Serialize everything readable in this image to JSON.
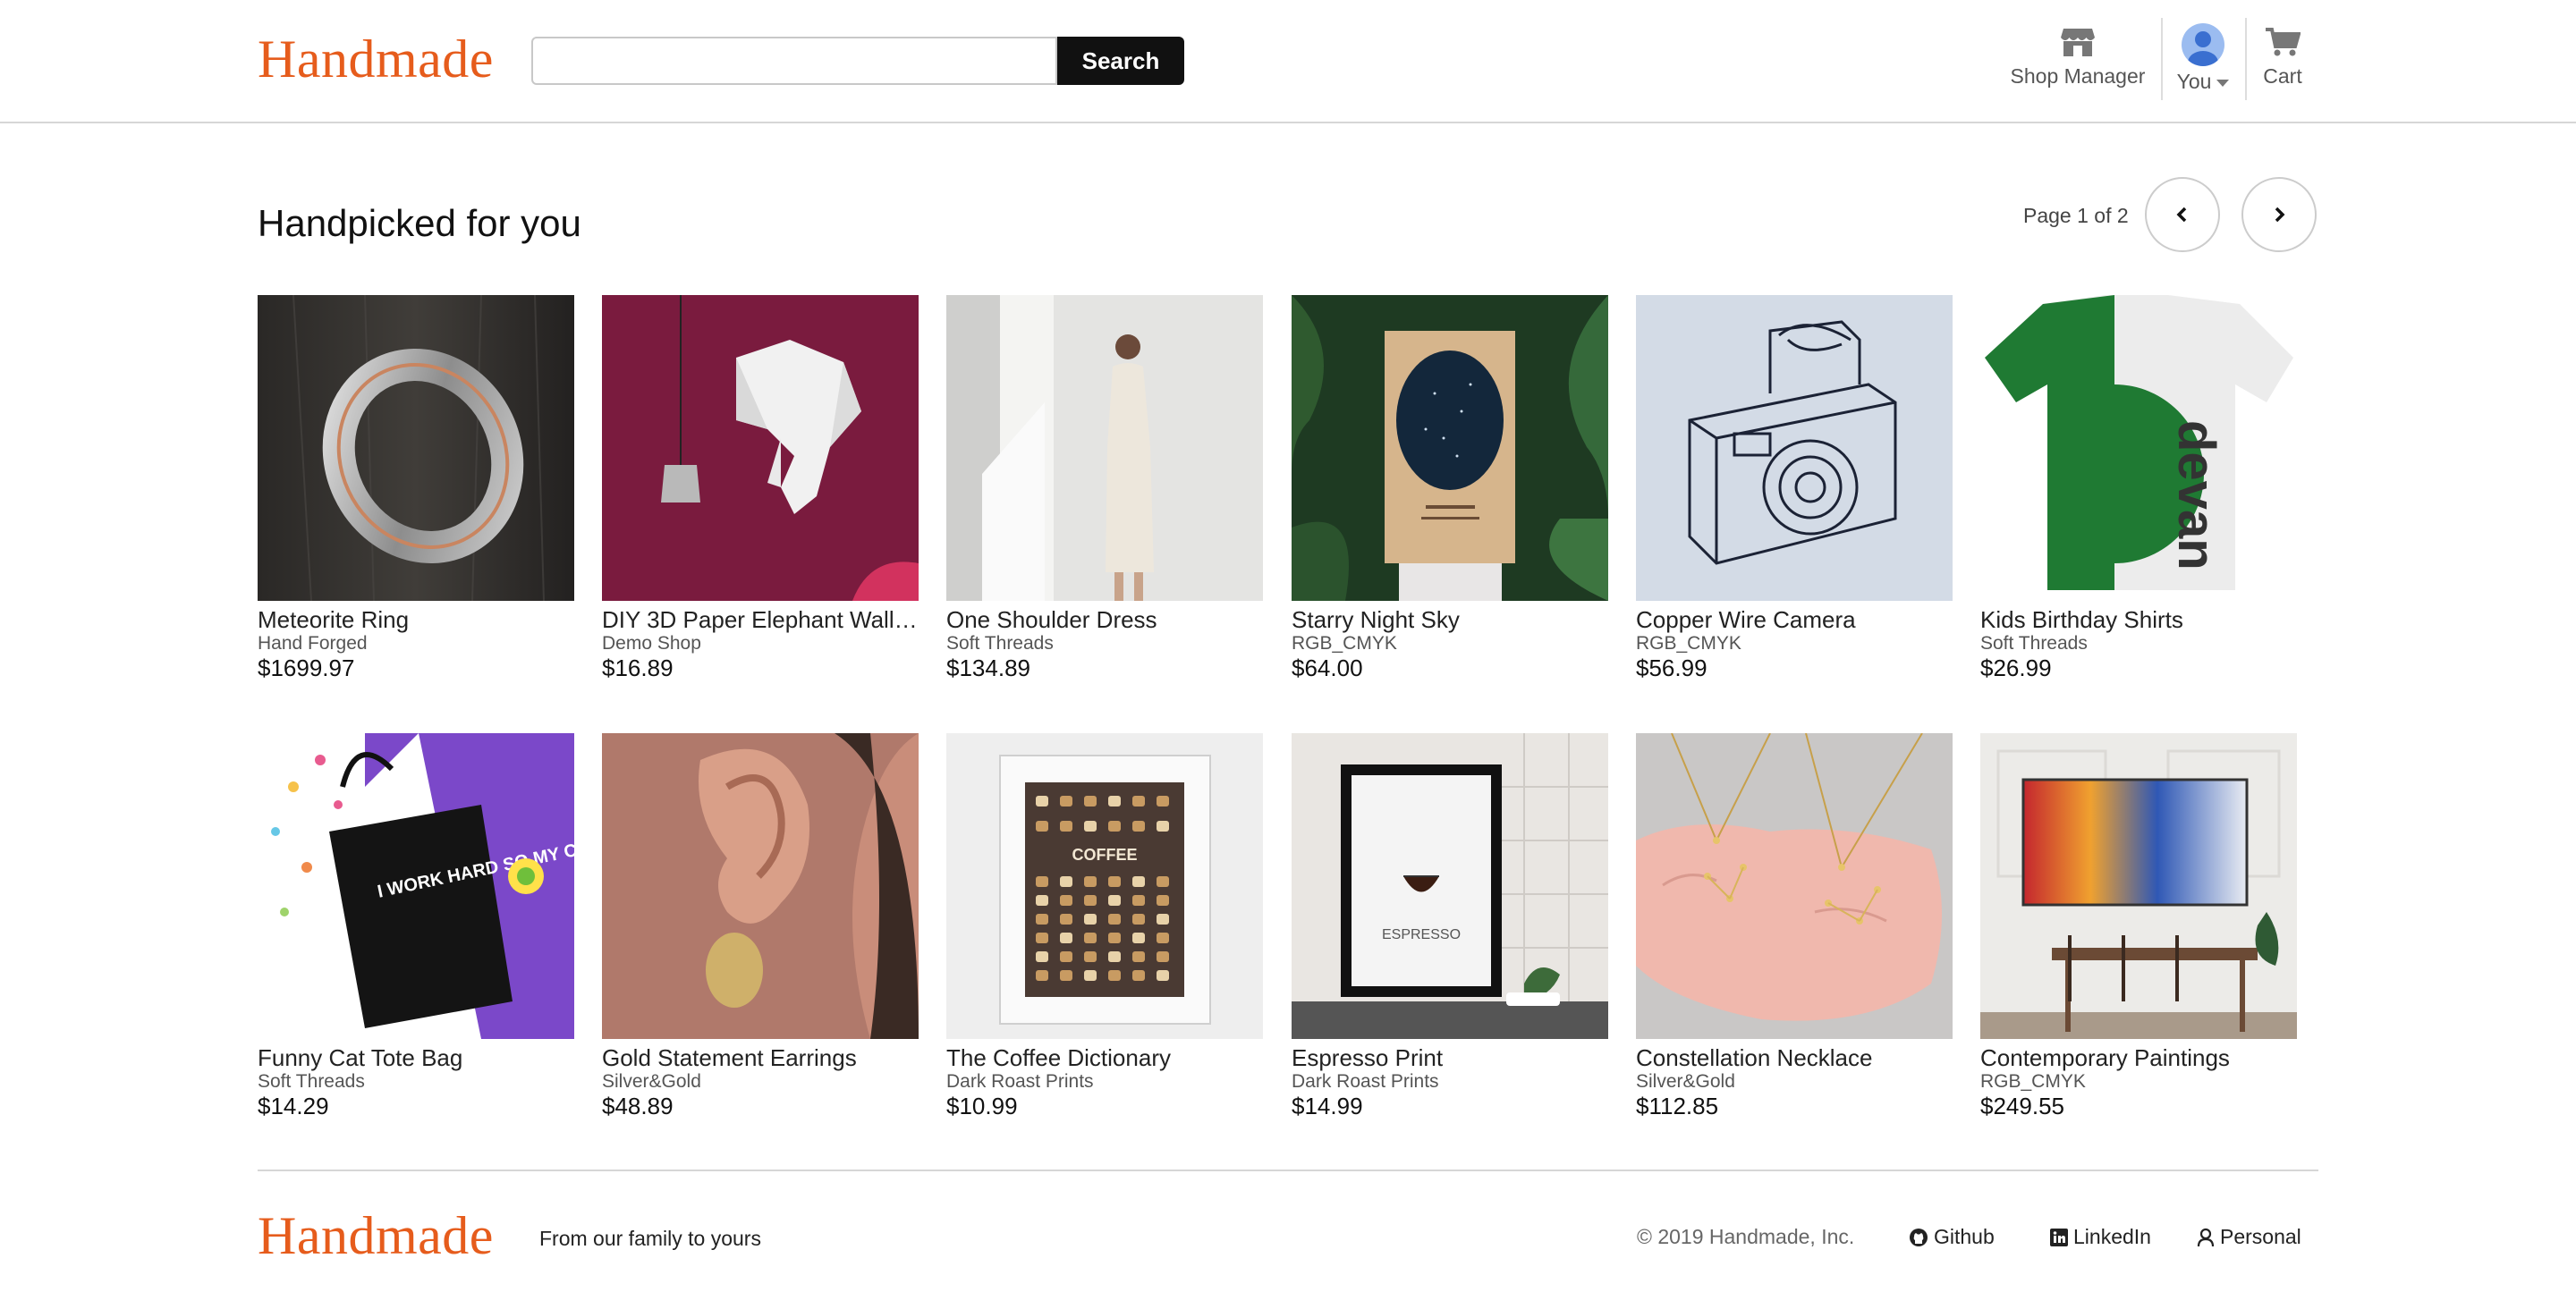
{
  "header": {
    "logo": "Handmade",
    "search_placeholder": "",
    "search_button": "Search",
    "nav": {
      "shop_manager": "Shop Manager",
      "you": "You",
      "cart": "Cart"
    }
  },
  "main": {
    "title": "Handpicked for you",
    "page_indicator": "Page 1 of 2",
    "products": [
      {
        "title": "Meteorite Ring",
        "shop": "Hand Forged",
        "price": "$1699.97",
        "image": "ring"
      },
      {
        "title": "DIY 3D Paper Elephant Wall ...",
        "shop": "Demo Shop",
        "price": "$16.89",
        "image": "elephant"
      },
      {
        "title": "One Shoulder Dress",
        "shop": "Soft Threads",
        "price": "$134.89",
        "image": "dress"
      },
      {
        "title": "Starry Night Sky",
        "shop": "RGB_CMYK",
        "price": "$64.00",
        "image": "starmap"
      },
      {
        "title": "Copper Wire Camera",
        "shop": "RGB_CMYK",
        "price": "$56.99",
        "image": "camera"
      },
      {
        "title": "Kids Birthday Shirts",
        "shop": "Soft Threads",
        "price": "$26.99",
        "image": "shirt"
      },
      {
        "title": "Funny Cat Tote Bag",
        "shop": "Soft Threads",
        "price": "$14.29",
        "image": "tote"
      },
      {
        "title": "Gold Statement Earrings",
        "shop": "Silver&Gold",
        "price": "$48.89",
        "image": "earring"
      },
      {
        "title": "The Coffee Dictionary",
        "shop": "Dark Roast Prints",
        "price": "$10.99",
        "image": "coffee-poster"
      },
      {
        "title": "Espresso Print",
        "shop": "Dark Roast Prints",
        "price": "$14.99",
        "image": "espresso"
      },
      {
        "title": "Constellation Necklace",
        "shop": "Silver&Gold",
        "price": "$112.85",
        "image": "necklace"
      },
      {
        "title": "Contemporary Paintings",
        "shop": "RGB_CMYK",
        "price": "$249.55",
        "image": "painting"
      }
    ],
    "image_text": {
      "shirt": "devan",
      "tote": "I WORK HARD SO MY CAT CAN HAVE A BETTER LIFE",
      "coffee": "COFFEE",
      "espresso": "ESPRESSO"
    }
  },
  "footer": {
    "logo": "Handmade",
    "tagline": "From our family to yours",
    "copyright": "© 2019 Handmade, Inc.",
    "links": {
      "github": "Github",
      "linkedin": "LinkedIn",
      "personal": "Personal"
    }
  },
  "colors": {
    "brand": "#e65c1c",
    "button": "#111111"
  }
}
